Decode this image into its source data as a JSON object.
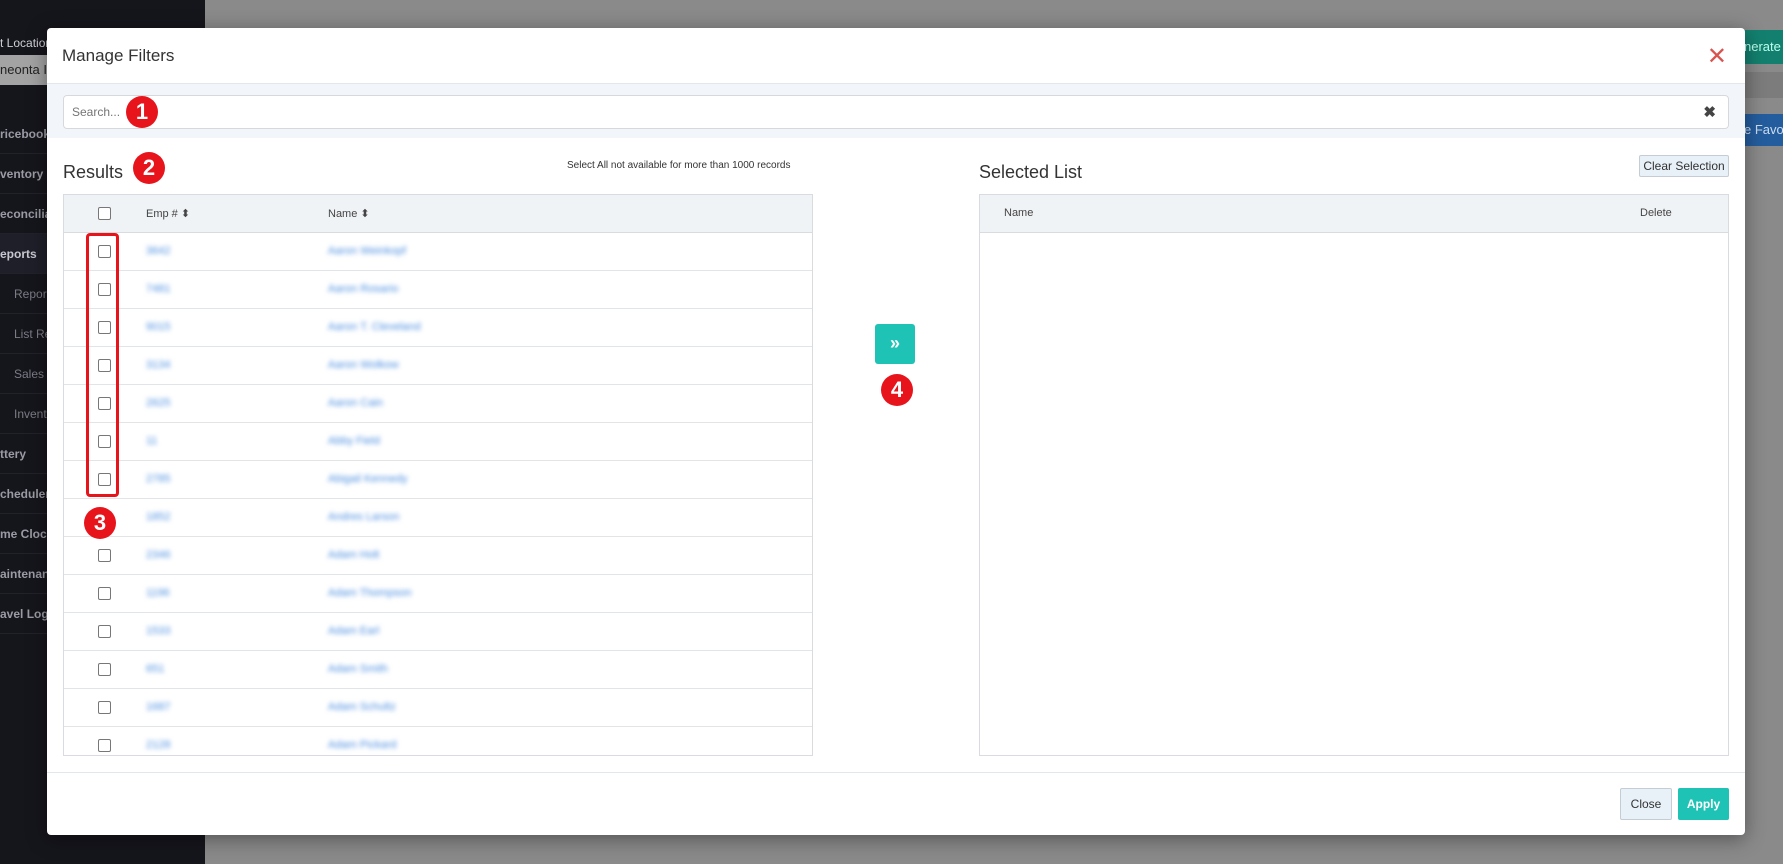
{
  "background": {
    "location_label": "t Location",
    "location_value": "neonta I",
    "sidebar": [
      "ricebook",
      "ventory",
      "econciliati",
      "eports",
      "Repor",
      "List Re",
      "Sales",
      "Invent",
      "ttery",
      "cheduler",
      "me Clock",
      "aintenanc",
      "avel Log"
    ],
    "btn_generate": "nerate I",
    "btn_favorite": "e Favor"
  },
  "modal": {
    "title": "Manage Filters",
    "search_placeholder": "Search...",
    "results_title": "Results",
    "select_all_note": "Select All not available for more than 1000 records",
    "columns": [
      "Emp #",
      "Name"
    ],
    "selected_title": "Selected List",
    "clear_selection": "Clear Selection",
    "selected_columns": [
      "Name",
      "Delete"
    ],
    "rows": [
      [
        "3642",
        "Aaron Weinkopf"
      ],
      [
        "7481",
        "Aaron Rosario"
      ],
      [
        "9015",
        "Aaron T. Cleveland"
      ],
      [
        "3134",
        "Aaron Wolkow"
      ],
      [
        "2625",
        "Aaron Cain"
      ],
      [
        "11",
        "Abby Field"
      ],
      [
        "2785",
        "Abigail Kennedy"
      ],
      [
        "1852",
        "Andres Larson"
      ],
      [
        "2346",
        "Adam Holt"
      ],
      [
        "1196",
        "Adam Thompson"
      ],
      [
        "1533",
        "Adam Earl"
      ],
      [
        "651",
        "Adam Smith"
      ],
      [
        "1687",
        "Adam Schultz"
      ],
      [
        "2128",
        "Adam Pickard"
      ]
    ],
    "close": "Close",
    "apply": "Apply"
  },
  "annotations": [
    "1",
    "2",
    "3",
    "4"
  ]
}
